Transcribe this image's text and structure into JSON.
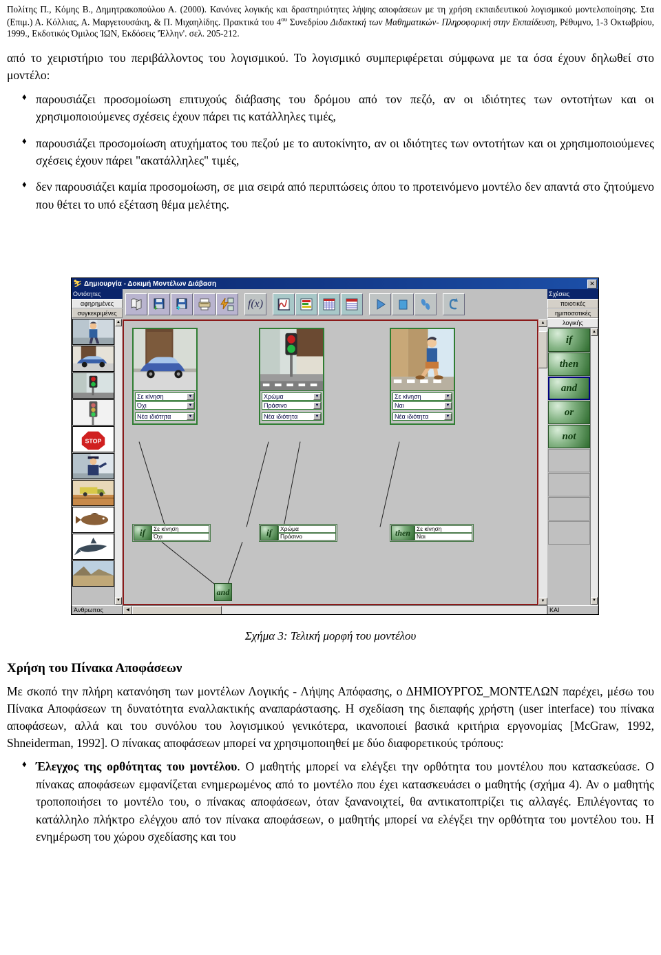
{
  "citation": {
    "line1_a": "Πολίτης Π., Κόμης Β., Δημητρακοπούλου Α.   (2000). Κανόνες λογικής και δραστηριότητες λήψης αποφάσεων με τη χρήση εκπαιδευτικού λογισμικού μοντελοποίησης. Στα (Επιμ.) Α. Κόλλιας, Α. Μαργετουσάκη, & Π. Μιχαηλίδης. Πρακτικά του 4",
    "sup": "ου",
    "line1_b": " Συνεδρίου ",
    "italic1": "Διδακτική των Μαθηματικών- Πληροφορική στην Εκπαίδευση",
    "line1_c": ", Ρέθυμνο, 1-3 Οκτωβρίου, 1999., Εκδοτικός Όμιλος ΊΩΝ, Εκδόσεις 'Έλλην'. σελ. 205-212."
  },
  "intro_paragraph": "από το χειριστήριο του περιβάλλοντος του λογισμικού. Το λογισμικό συμπεριφέρεται σύμφωνα με τα όσα έχουν δηλωθεί στο μοντέλο:",
  "bullets": [
    "παρουσιάζει προσομοίωση επιτυχούς διάβασης του δρόμου από τον πεζό, αν οι ιδιότητες των οντοτήτων και οι χρησιμοποιούμενες σχέσεις έχουν πάρει τις κατάλληλες τιμές,",
    "παρουσιάζει προσομοίωση ατυχήματος του πεζού με το αυτοκίνητο, αν οι ιδιότητες των οντοτήτων και οι χρησιμοποιούμενες σχέσεις έχουν πάρει \"ακατάλληλες\" τιμές,",
    "δεν παρουσιάζει καμία προσομοίωση, σε μια σειρά από περιπτώσεις όπου το προτεινόμενο μοντέλο δεν απαντά στο ζητούμενο που θέτει το υπό εξέταση θέμα μελέτης."
  ],
  "figure_caption": "Σχήμα 3: Τελική μορφή του μοντέλου",
  "section": {
    "heading": "Χρήση του Πίνακα Αποφάσεων",
    "paragraph": "Με σκοπό την πλήρη κατανόηση των μοντέλων Λογικής - Λήψης Απόφασης, ο ΔΗΜΙΟΥΡΓΟΣ_ΜΟΝΤΕΛΩΝ παρέχει, μέσω του Πίνακα Αποφάσεων τη δυνατότητα εναλλακτικής αναπαράστασης. Η σχεδίαση της διεπαφής χρήστη (user interface) του πίνακα αποφάσεων, αλλά και του συνόλου του λογισμικού γενικότερα, ικανοποιεί βασικά κριτήρια εργονομίας [McGraw, 1992, Shneiderman, 1992]. Ο πίνακας αποφάσεων μπορεί να χρησιμοποιηθεί με δύο διαφορετικούς τρόπους:",
    "final_bullet_bold": "Έλεγχος της ορθότητας του μοντέλου",
    "final_bullet_rest": ". Ο μαθητής μπορεί να ελέγξει την ορθότητα του μοντέλου που κατασκεύασε. Ο πίνακας αποφάσεων εμφανίζεται ενημερωμένος από το μοντέλο που έχει κατασκευάσει ο μαθητής (σχήμα 4). Αν ο μαθητής τροποποιήσει το μοντέλο του, ο πίνακας αποφάσεων, όταν ξανανοιχτεί, θα αντικατοπτρίζει τις αλλαγές. Επιλέγοντας το κατάλληλο πλήκτρο ελέγχου από τον πίνακα αποφάσεων, ο μαθητής μπορεί να ελέγξει την ορθότητα του μοντέλου του. Η ενημέρωση του χώρου σχεδίασης και του"
  },
  "app": {
    "title": "Δημιουργία - Δοκιμή Μοντέλων Διάβαση",
    "close_label": "✕",
    "entities_panel": {
      "header": "Οντότητες",
      "tabs": [
        {
          "label": "αφηρημένες",
          "active": true
        },
        {
          "label": "συγκεκριμένες",
          "active": false
        }
      ],
      "items": [
        {
          "name": "pedestrian-boy"
        },
        {
          "name": "blue-car"
        },
        {
          "name": "traffic-light-pedestrian"
        },
        {
          "name": "traffic-light-vehicle"
        },
        {
          "name": "stop-sign"
        },
        {
          "name": "police-officer"
        },
        {
          "name": "truck"
        },
        {
          "name": "fish-brown"
        },
        {
          "name": "shark"
        },
        {
          "name": "landscape"
        }
      ],
      "status": "Άνθρωπος",
      "scroll_up": "▲",
      "scroll_down": "▼"
    },
    "relations_panel": {
      "header": "Σχέσεις",
      "tabs": [
        {
          "label": "ποιοτικές",
          "active": false
        },
        {
          "label": "ημιποσοτικές",
          "active": false
        },
        {
          "label": "λογικής",
          "active": true
        }
      ],
      "logic_blocks": [
        {
          "label": "if",
          "selected": false
        },
        {
          "label": "then",
          "selected": false
        },
        {
          "label": "and",
          "selected": true
        },
        {
          "label": "or",
          "selected": false
        },
        {
          "label": "not",
          "selected": false
        }
      ],
      "empty_slots": 4,
      "status": "ΚΑΙ",
      "scroll_up": "▲",
      "scroll_down": "▼"
    },
    "toolbar": {
      "groups": [
        {
          "buttons": [
            {
              "name": "new-document-icon",
              "style": "violet"
            },
            {
              "name": "save-icon",
              "style": "violet"
            },
            {
              "name": "open-icon",
              "style": "violet"
            },
            {
              "name": "print-icon",
              "style": "violet"
            },
            {
              "name": "network-link-icon",
              "style": "violet"
            }
          ]
        },
        {
          "buttons": [
            {
              "name": "function-fx-icon",
              "style": "grey",
              "text": "f(x)"
            }
          ]
        },
        {
          "buttons": [
            {
              "name": "line-chart-icon",
              "style": "teal"
            },
            {
              "name": "bar-chart-icon",
              "style": "teal"
            },
            {
              "name": "grid-table-icon",
              "style": "teal"
            },
            {
              "name": "data-table-icon",
              "style": "teal"
            }
          ]
        },
        {
          "buttons": [
            {
              "name": "play-icon",
              "style": "grey"
            },
            {
              "name": "stop-icon",
              "style": "grey"
            },
            {
              "name": "step-footprints-icon",
              "style": "grey"
            }
          ]
        },
        {
          "buttons": [
            {
              "name": "undo-icon",
              "style": "grey"
            }
          ]
        }
      ]
    },
    "canvas": {
      "objects": [
        {
          "name": "car-object",
          "thumb": "blue-car",
          "property": "Σε κίνηση",
          "value": "Όχι",
          "new_property": "Νέα ιδιότητα"
        },
        {
          "name": "traffic-light-object",
          "thumb": "traffic-light-pedestrian",
          "property": "Χρώμα",
          "value": "Πράσινο",
          "new_property": "Νέα ιδιότητα"
        },
        {
          "name": "pedestrian-object",
          "thumb": "pedestrian-boy",
          "property": "Σε κίνηση",
          "value": "Ναι",
          "new_property": "Νέα ιδιότητα"
        }
      ],
      "rules": [
        {
          "name": "if-rule-car",
          "keyword": "if",
          "property": "Σε κίνηση",
          "value": "Όχι"
        },
        {
          "name": "if-rule-light",
          "keyword": "if",
          "property": "Χρώμα",
          "value": "Πράσινο"
        },
        {
          "name": "then-rule-pedestrian",
          "keyword": "then",
          "property": "Σε κίνηση",
          "value": "Ναι"
        }
      ],
      "connector": {
        "name": "and-connector",
        "label": "and"
      },
      "dropdown_arrow": "▼"
    }
  }
}
